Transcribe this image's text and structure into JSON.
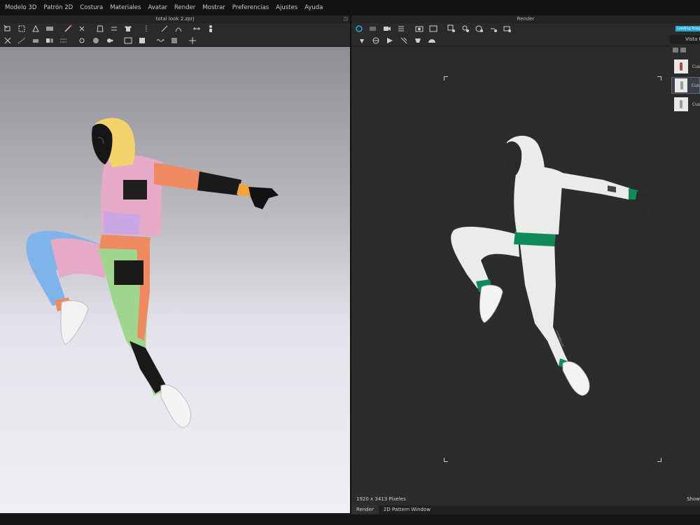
{
  "menu": {
    "items": [
      "Modelo 3D",
      "Patrón 2D",
      "Costura",
      "Materiales",
      "Avatar",
      "Render",
      "Mostrar",
      "Preferencias",
      "Ajustes",
      "Ayuda"
    ]
  },
  "window3d": {
    "title": "total look 2.zprj"
  },
  "render_window": {
    "title": "Render",
    "resolution_text": "1920 x 3413 Píxeles",
    "show_label": "Show"
  },
  "side_panel": {
    "loading_label": "Loading Images",
    "tab_label": "Vista P",
    "thumbnails": [
      {
        "label": "Cus"
      },
      {
        "label": "Cus"
      },
      {
        "label": "Cus"
      }
    ]
  },
  "bottom_tabs": [
    "Render",
    "2D Pattern Window"
  ],
  "colors": {
    "hood_left": "#f2d36b",
    "top_pink": "#e6a9c8",
    "sleeve_orange": "#ef8a60",
    "pants_green": "#9fd68e",
    "pants_blue": "#7fb4ea",
    "render_garment": "#e9ece8",
    "render_trim": "#0f8a5a",
    "loading_accent": "#29a7d8"
  }
}
